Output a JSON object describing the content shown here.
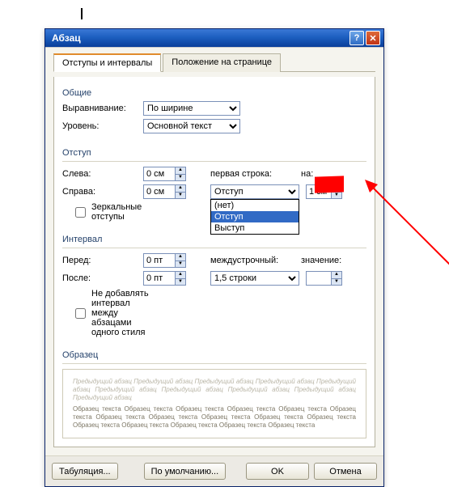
{
  "window_title": "Абзац",
  "tabs": {
    "active": "Отступы и интервалы",
    "inactive": "Положение на странице"
  },
  "general": {
    "group": "Общие",
    "alignment_label": "Выравнивание:",
    "alignment_value": "По ширине",
    "level_label": "Уровень:",
    "level_value": "Основной текст"
  },
  "indent": {
    "group": "Отступ",
    "left_label": "Слева:",
    "left_value": "0 см",
    "right_label": "Справа:",
    "right_value": "0 см",
    "first_line_label": "первая строка:",
    "first_line_value": "Отступ",
    "by_label": "на:",
    "by_value": "1 см",
    "mirror": "Зеркальные отступы",
    "options": [
      "(нет)",
      "Отступ",
      "Выступ"
    ],
    "selected_option": "Отступ"
  },
  "spacing": {
    "group": "Интервал",
    "before_label": "Перед:",
    "before_value": "0 пт",
    "after_label": "После:",
    "after_value": "0 пт",
    "line_label": "междустрочный:",
    "line_value": "1,5 строки",
    "at_label": "значение:",
    "at_value": "",
    "nostyle": "Не добавлять интервал между абзацами одного стиля"
  },
  "sample": {
    "group": "Образец",
    "prev": "Предыдущий абзац Предыдущий абзац Предыдущий абзац Предыдущий абзац Предыдущий абзац Предыдущий абзац Предыдущий абзац Предыдущий абзац Предыдущий абзац Предыдущий абзац",
    "mid": "Образец текста Образец текста Образец текста Образец текста Образец текста Образец текста Образец текста Образец текста Образец текста Образец текста Образец текста Образец текста Образец текста Образец текста Образец текста Образец текста",
    "next": ""
  },
  "buttons": {
    "tabs": "Табуляция...",
    "default": "По умолчанию...",
    "ok": "OK",
    "cancel": "Отмена"
  }
}
